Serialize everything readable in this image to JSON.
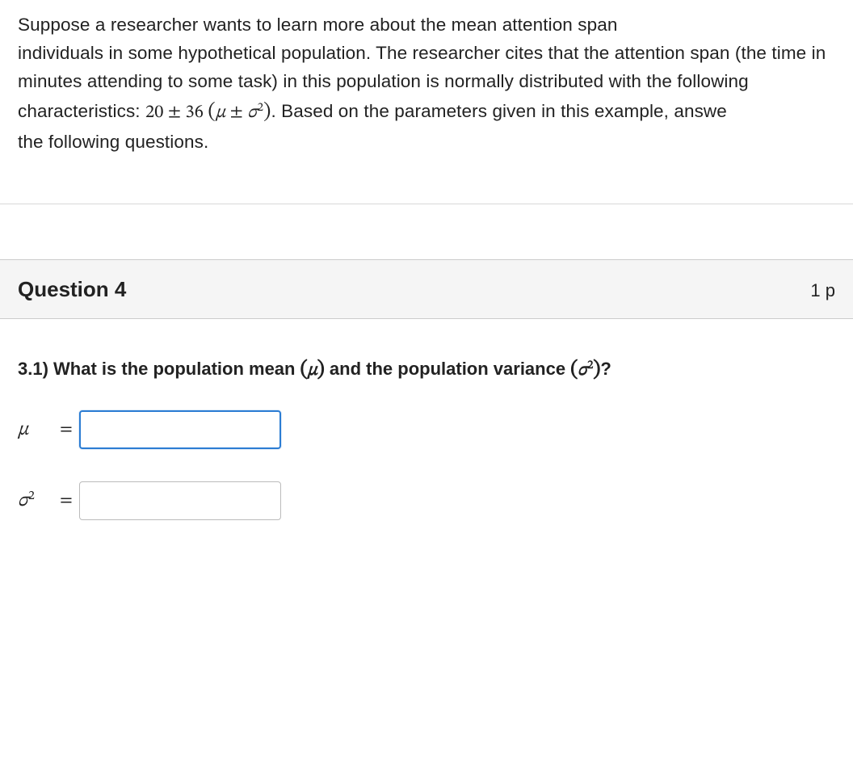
{
  "intro": {
    "text_part1": "Suppose a researcher wants to learn more about the mean attention span ",
    "text_part2": "individuals in some hypothetical population. The researcher cites that the attention span (the time in minutes attending to some task) in this population is normally distributed with the following characteristics: ",
    "formula_plain": "20 ± 36 (μ ± σ²)",
    "text_part3": ". Based on the parameters given in this example, answe",
    "text_part4": "the following questions."
  },
  "question": {
    "title": "Question 4",
    "points": "1 p"
  },
  "prompt": {
    "number": "3.1) ",
    "text1": "What is the population mean ",
    "var1": "(μ)",
    "text2": " and the population variance ",
    "var2": "(σ²)",
    "qmark": "?"
  },
  "answers": {
    "mu": {
      "label": "μ",
      "eq": "=",
      "value": ""
    },
    "sigma2": {
      "label_sigma": "σ",
      "label_sup": "2",
      "eq": "=",
      "value": ""
    }
  }
}
